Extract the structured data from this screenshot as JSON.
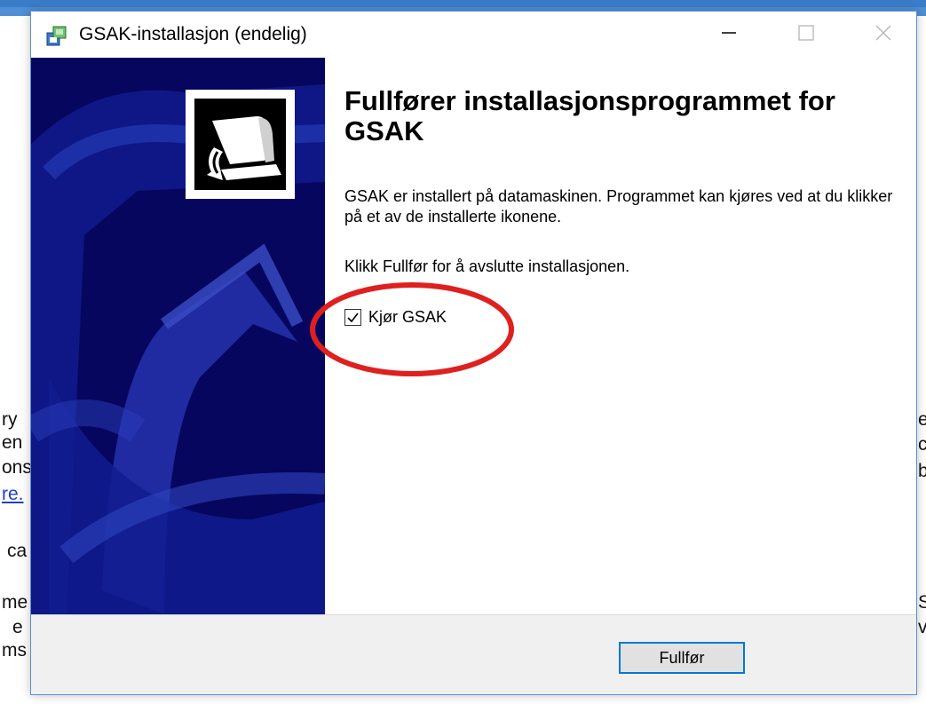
{
  "background": {
    "fragments_left": [
      "ry",
      "en",
      "ons",
      "re.",
      "ca",
      "me",
      "e",
      "ms"
    ],
    "fragments_right": [
      "e",
      "c",
      "b",
      "S",
      "v"
    ]
  },
  "dialog": {
    "title": "GSAK-installasjon (endelig)",
    "heading": "Fullfører installasjonsprogrammet for GSAK",
    "paragraph1": "GSAK er installert på datamaskinen. Programmet kan kjøres ved at du klikker på et av de installerte ikonene.",
    "paragraph2": "Klikk Fullfør for å avslutte installasjonen.",
    "checkbox": {
      "label": "Kjør GSAK",
      "checked": true
    },
    "finish_button": "Fullfør"
  },
  "colors": {
    "sidebar": "#06065e",
    "annotation_circle": "#e01f1f",
    "button_focus": "#0078d7"
  }
}
